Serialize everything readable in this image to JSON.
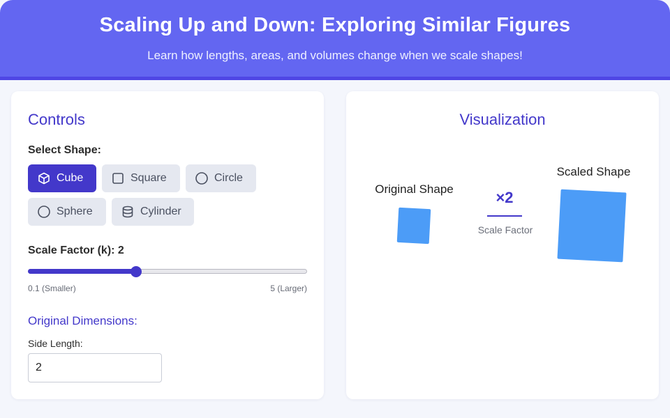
{
  "header": {
    "title": "Scaling Up and Down: Exploring Similar Figures",
    "subtitle": "Learn how lengths, areas, and volumes change when we scale shapes!"
  },
  "controls": {
    "title": "Controls",
    "select_shape_label": "Select Shape:",
    "shapes": [
      {
        "label": "Cube",
        "icon": "cube-icon",
        "active": true
      },
      {
        "label": "Square",
        "icon": "square-icon",
        "active": false
      },
      {
        "label": "Circle",
        "icon": "circle-icon",
        "active": false
      },
      {
        "label": "Sphere",
        "icon": "sphere-icon",
        "active": false
      },
      {
        "label": "Cylinder",
        "icon": "cylinder-icon",
        "active": false
      }
    ],
    "scale_factor_label": "Scale Factor (k): 2",
    "scale": {
      "min": 0.1,
      "max": 5,
      "value": 2
    },
    "range_min_label": "0.1 (Smaller)",
    "range_max_label": "5 (Larger)",
    "original_dimensions_title": "Original Dimensions:",
    "side_length_label": "Side Length:",
    "side_length_value": "2"
  },
  "visualization": {
    "title": "Visualization",
    "original_label": "Original Shape",
    "scaled_label": "Scaled Shape",
    "multiplier": "×2",
    "scale_caption": "Scale Factor"
  },
  "colors": {
    "header": "#6366f1",
    "accent": "#4338ca",
    "shape_fill": "#4c9cf7",
    "button_inactive": "#e5e8f0"
  }
}
